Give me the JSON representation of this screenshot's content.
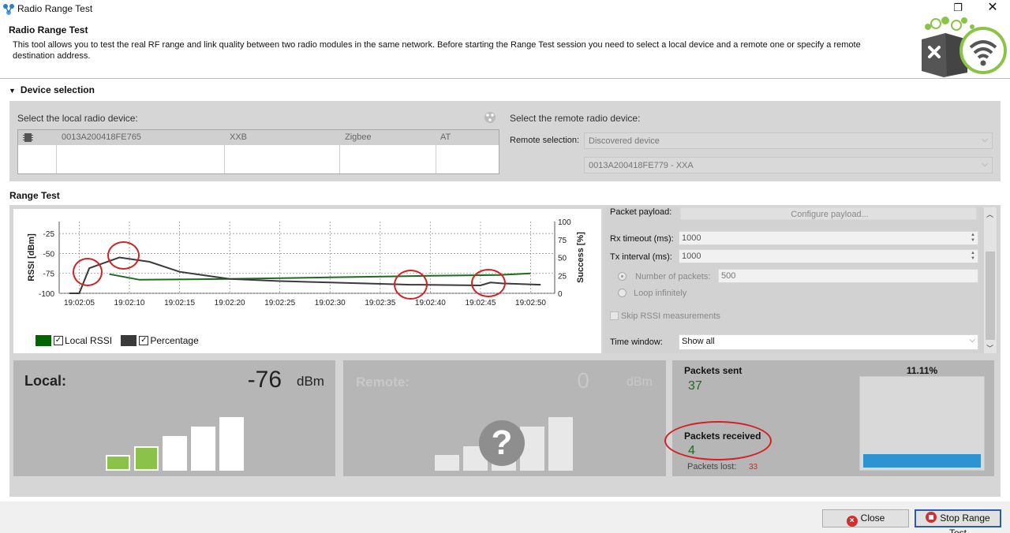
{
  "window": {
    "title": "Radio Range Test",
    "restore_glyph": "❐",
    "close_glyph": "✕"
  },
  "header": {
    "title": "Radio Range Test",
    "description": "This tool allows you to test the real RF range and link quality between two radio modules in the same network. Before starting the Range Test session you need to select a local device and a remote one or specify a remote destination address."
  },
  "device_selection": {
    "section_label": "Device selection",
    "local_label": "Select the local radio device:",
    "local_device": {
      "address": "0013A200418FE765",
      "protocol": "XXB",
      "stack": "Zigbee",
      "mode": "AT"
    },
    "remote_label": "Select the remote radio device:",
    "remote_selection_label": "Remote selection:",
    "remote_selection_value": "Discovered device",
    "remote_device_value": "0013A200418FE779 - XXA"
  },
  "range_test": {
    "section_label": "Range Test",
    "legend": [
      {
        "name": "Local RSSI",
        "color": "#006400",
        "checked": true
      },
      {
        "name": "Percentage",
        "color": "#3a3a3a",
        "checked": true
      }
    ],
    "settings": {
      "payload_label": "Packet payload:",
      "payload_button": "Configure payload...",
      "rx_timeout_label": "Rx timeout (ms):",
      "rx_timeout_value": "1000",
      "tx_interval_label": "Tx interval (ms):",
      "tx_interval_value": "1000",
      "num_packets_label": "Number of packets:",
      "num_packets_value": "500",
      "loop_label": "Loop infinitely",
      "skip_rssi_label": "Skip RSSI measurements",
      "time_window_label": "Time window:",
      "time_window_value": "Show all"
    },
    "local_signal": {
      "label": "Local:",
      "value": "-76",
      "unit": "dBm",
      "bars_lit": 2,
      "bars_total": 5
    },
    "remote_signal": {
      "label": "Remote:",
      "value": "0",
      "unit": "dBm",
      "question": "?"
    },
    "packets": {
      "sent_label": "Packets sent",
      "sent_value": "37",
      "received_label": "Packets received",
      "received_value": "4",
      "lost_label": "Packets lost:",
      "lost_value": "33",
      "percent_label": "11.11%",
      "percent_fraction": 0.1111
    }
  },
  "buttons": {
    "close": "Close",
    "stop": "Stop Range Test"
  },
  "colors": {
    "rssi_line": "#1e6b1e",
    "percentage_line": "#3a3a3a",
    "signal_on": "#8bc34a",
    "progress": "#2e93d1",
    "annotation": "#d32020"
  },
  "chart_data": {
    "type": "line",
    "title": "",
    "ylabel": "RSSI [dBm]",
    "y2label": "Success [%]",
    "ylim": [
      -100,
      -10
    ],
    "y2lim": [
      0,
      100
    ],
    "yticks": [
      "-25",
      "-50",
      "-75",
      "-100"
    ],
    "y2ticks": [
      "100",
      "75",
      "50",
      "25",
      "0"
    ],
    "xticks": [
      "19:02:05",
      "19:02:10",
      "19:02:15",
      "19:02:20",
      "19:02:25",
      "19:02:30",
      "19:02:35",
      "19:02:40",
      "19:02:45",
      "19:02:50"
    ],
    "series": [
      {
        "name": "Local RSSI",
        "axis": "left",
        "x": [
          "19:02:08",
          "19:02:11",
          "19:02:20",
          "19:02:30",
          "19:02:40",
          "19:02:47",
          "19:02:50"
        ],
        "values": [
          -76,
          -83,
          -82,
          -80,
          -78,
          -77,
          -75
        ]
      },
      {
        "name": "Percentage",
        "axis": "right",
        "x": [
          "19:02:04",
          "19:02:05",
          "19:02:06",
          "19:02:07",
          "19:02:09",
          "19:02:12",
          "19:02:15",
          "19:02:20",
          "19:02:25",
          "19:02:30",
          "19:02:38",
          "19:02:39",
          "19:02:45",
          "19:02:46",
          "19:02:47",
          "19:02:51"
        ],
        "values": [
          0,
          0,
          35,
          40,
          50,
          44,
          30,
          20,
          17,
          15,
          12,
          12,
          11,
          15,
          14,
          12
        ]
      }
    ]
  }
}
